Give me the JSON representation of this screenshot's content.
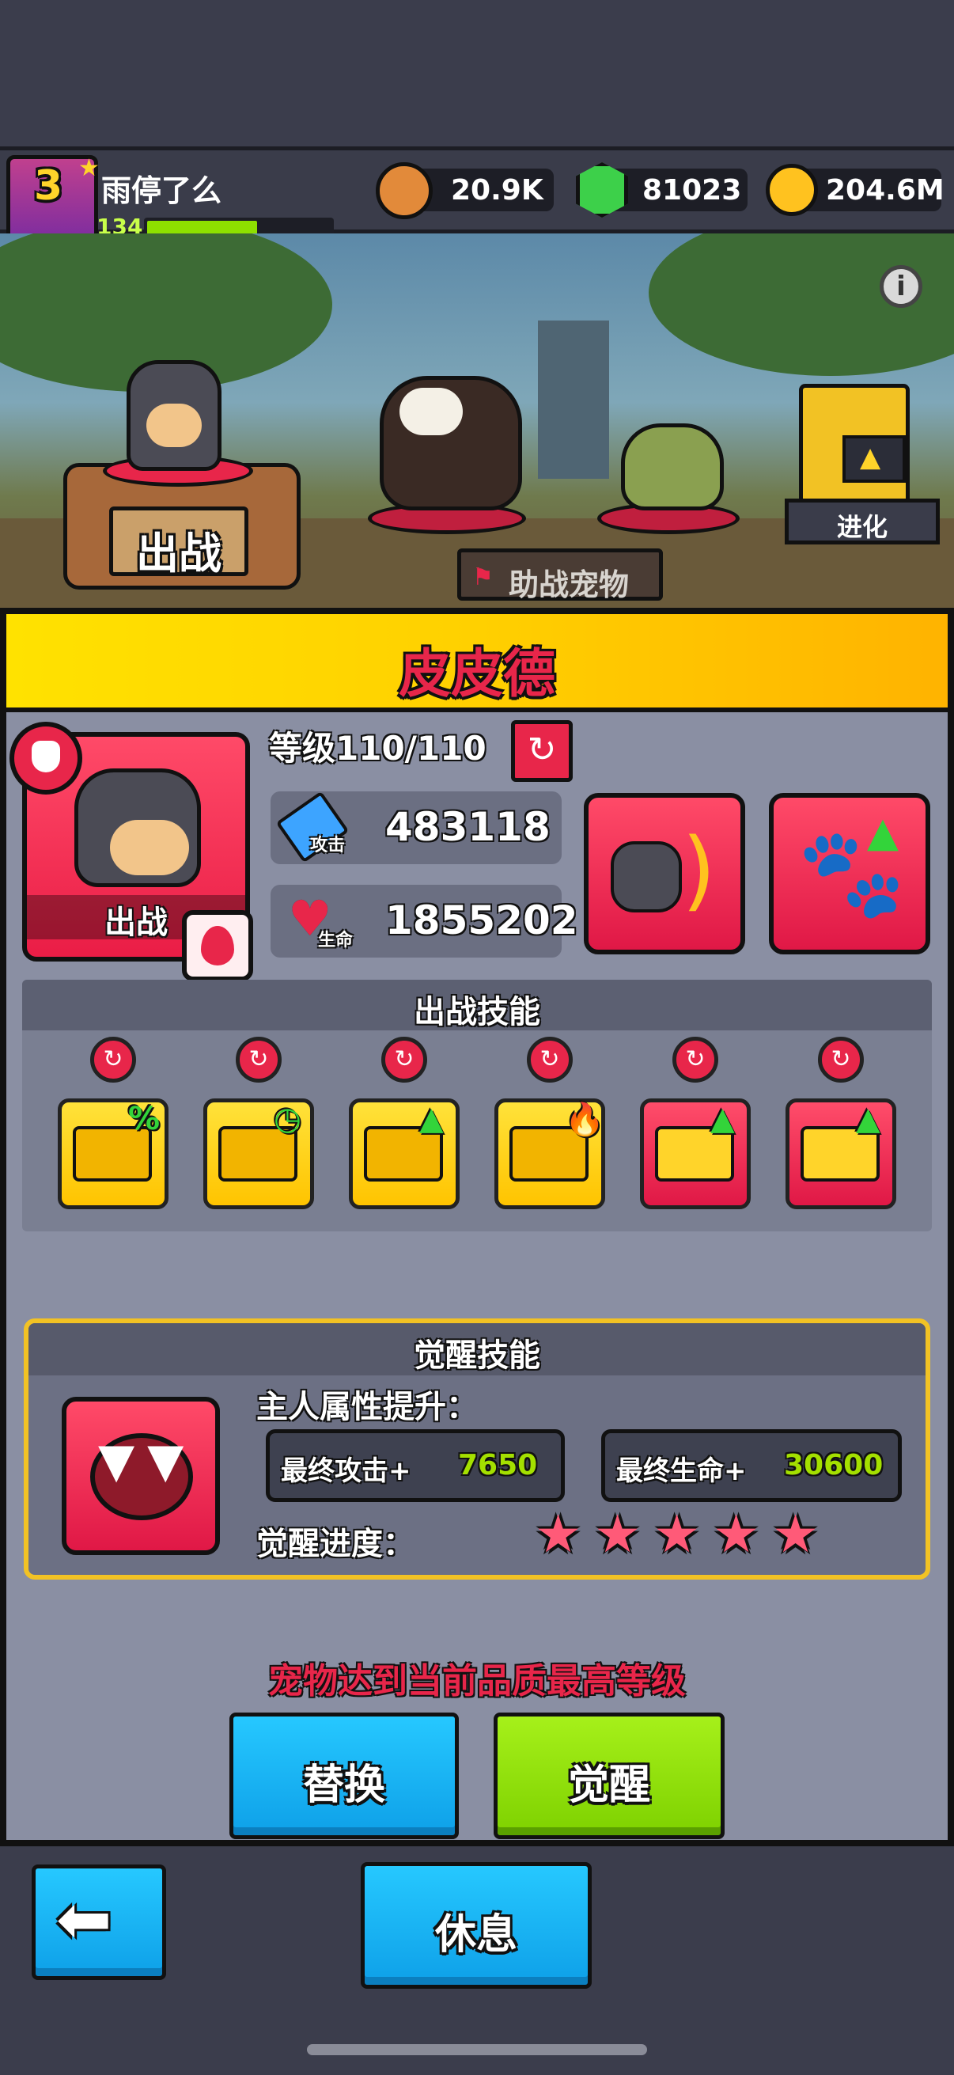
{
  "player": {
    "name": "雨停了么",
    "vip_level": "3",
    "level": "134",
    "xp_fraction": 0.6
  },
  "currencies": [
    {
      "icon": "lion-coin-icon",
      "value": "20.9K"
    },
    {
      "icon": "green-gem-icon",
      "value": "81023"
    },
    {
      "icon": "gold-coin-icon",
      "value": "204.6M"
    }
  ],
  "scene": {
    "deploy_label": "出战",
    "assist_label": "助战宠物",
    "evolve_label": "进化"
  },
  "pet": {
    "name": "皮皮德",
    "level_text": "等级110/110",
    "portrait_label": "出战",
    "attack_label": "攻击",
    "attack": "483118",
    "hp_label": "生命",
    "hp": "1855202"
  },
  "battle_skills": {
    "title": "出战技能",
    "skills": [
      {
        "icon": "armor-percent-icon",
        "tile": "yellow"
      },
      {
        "icon": "paw-cooldown-icon",
        "tile": "yellow"
      },
      {
        "icon": "card-up-icon",
        "tile": "yellow"
      },
      {
        "icon": "paw-fire-icon",
        "tile": "yellow"
      },
      {
        "icon": "armor-gear-up-icon",
        "tile": "red"
      },
      {
        "icon": "armor-bullet-up-icon",
        "tile": "red"
      }
    ]
  },
  "awaken": {
    "title": "觉醒技能",
    "owner_bonus_label": "主人属性提升：",
    "final_attack_label": "最终攻击+",
    "final_attack_value": "7650",
    "final_hp_label": "最终生命+",
    "final_hp_value": "30600",
    "progress_label": "觉醒进度：",
    "stars": 5
  },
  "max_level_notice": "宠物达到当前品质最高等级",
  "buttons": {
    "replace": "替换",
    "awaken": "觉醒",
    "rest": "休息"
  },
  "colors": {
    "banner": "#ffd000",
    "red_accent": "#e8264a",
    "cyan_button": "#17b8f0",
    "green_button": "#8fe000",
    "bonus_value": "#a4e000"
  }
}
